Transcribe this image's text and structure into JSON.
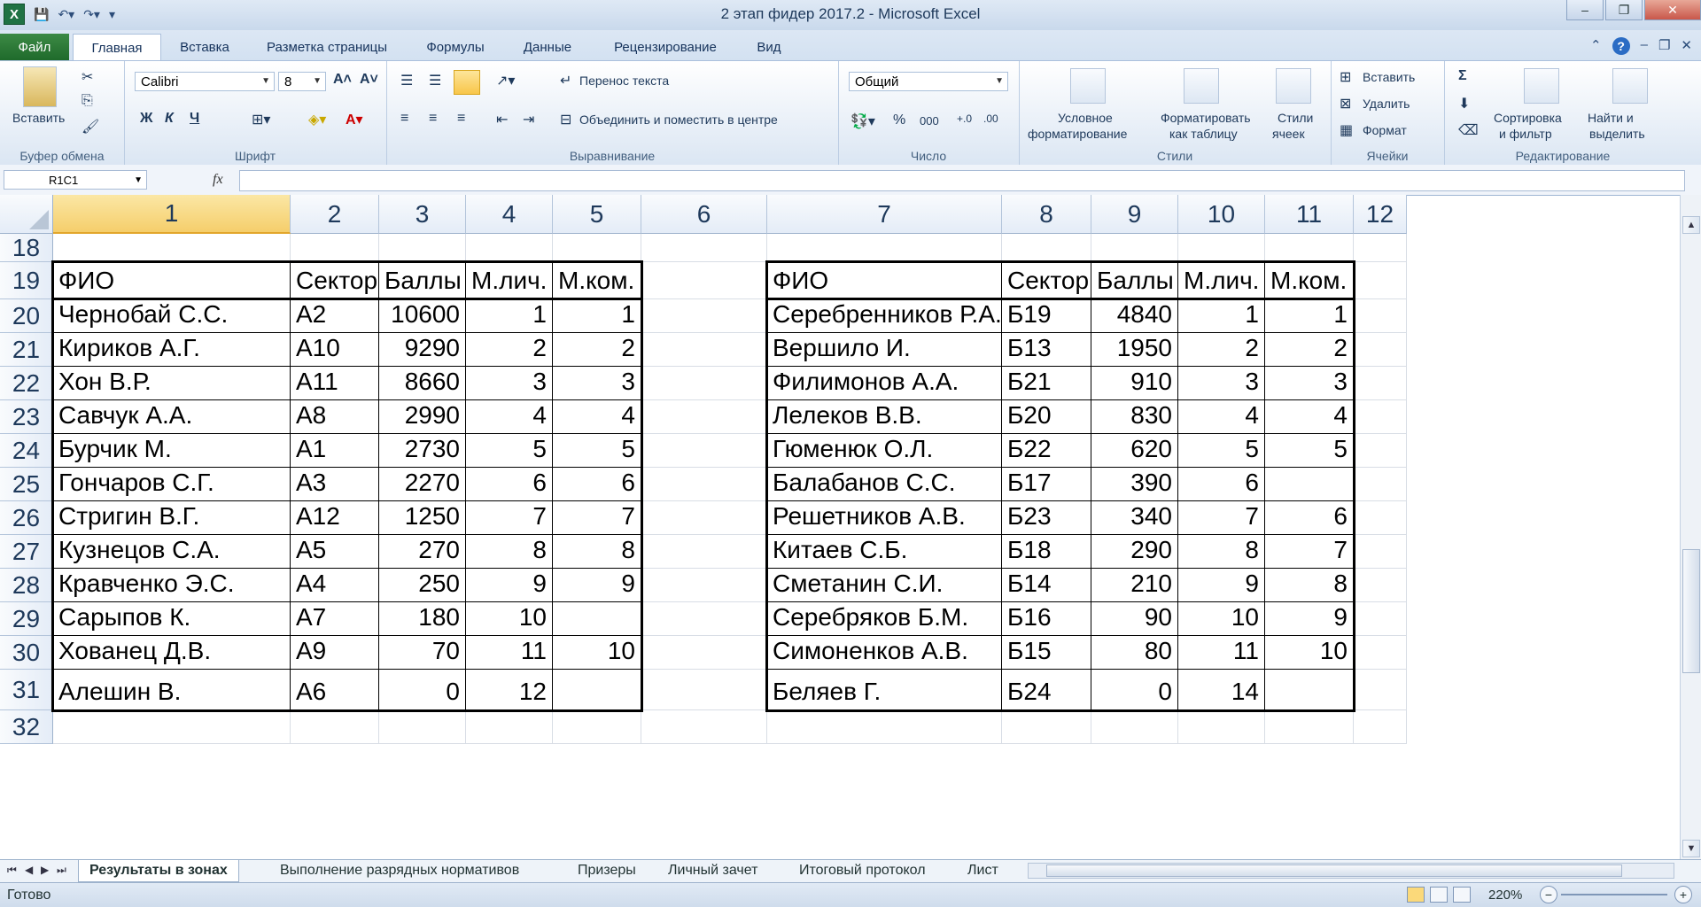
{
  "window": {
    "title": "2 этап фидер 2017.2 - Microsoft Excel",
    "controls": {
      "minimize": "–",
      "restore": "❐",
      "close": "✕"
    }
  },
  "ribbon_tabs": [
    {
      "label": "Файл"
    },
    {
      "label": "Главная"
    },
    {
      "label": "Вставка"
    },
    {
      "label": "Разметка страницы"
    },
    {
      "label": "Формулы"
    },
    {
      "label": "Данные"
    },
    {
      "label": "Рецензирование"
    },
    {
      "label": "Вид"
    }
  ],
  "ribbon": {
    "clipboard": {
      "label": "Буфер обмена",
      "paste": "Вставить"
    },
    "font": {
      "label": "Шрифт",
      "name": "Calibri",
      "size": "8",
      "bold": "Ж",
      "italic": "К",
      "underline": "Ч"
    },
    "alignment": {
      "label": "Выравнивание",
      "wrap": "Перенос текста",
      "merge": "Объединить и поместить в центре"
    },
    "number": {
      "label": "Число",
      "format": "Общий",
      "percent": "%",
      "thousands": "000"
    },
    "styles": {
      "label": "Стили",
      "conditional": "Условное",
      "conditional2": "форматирование",
      "table": "Форматировать",
      "table2": "как таблицу",
      "cell": "Стили",
      "cell2": "ячеек"
    },
    "cells": {
      "label": "Ячейки",
      "insert": "Вставить",
      "delete": "Удалить",
      "format": "Формат"
    },
    "editing": {
      "label": "Редактирование",
      "sort": "Сортировка",
      "sort2": "и фильтр",
      "find": "Найти и",
      "find2": "выделить",
      "sum": "Σ"
    }
  },
  "formula_bar": {
    "name_box": "R1C1",
    "fx": "fx",
    "value": ""
  },
  "columns": [
    "1",
    "2",
    "3",
    "4",
    "5",
    "6",
    "7",
    "8",
    "9",
    "10",
    "11",
    "12"
  ],
  "rows": [
    "18",
    "19",
    "20",
    "21",
    "22",
    "23",
    "24",
    "25",
    "26",
    "27",
    "28",
    "29",
    "30",
    "31",
    "32"
  ],
  "table_left": {
    "headers": [
      "ФИО",
      "Сектор",
      "Баллы",
      "М.лич.",
      "М.ком."
    ],
    "rows": [
      [
        "Чернобай С.С.",
        "А2",
        "10600",
        "1",
        "1"
      ],
      [
        "Кириков А.Г.",
        "А10",
        "9290",
        "2",
        "2"
      ],
      [
        "Хон В.Р.",
        "А11",
        "8660",
        "3",
        "3"
      ],
      [
        "Савчук А.А.",
        "А8",
        "2990",
        "4",
        "4"
      ],
      [
        "Бурчик М.",
        "А1",
        "2730",
        "5",
        "5"
      ],
      [
        "Гончаров С.Г.",
        "А3",
        "2270",
        "6",
        "6"
      ],
      [
        "Стригин В.Г.",
        "А12",
        "1250",
        "7",
        "7"
      ],
      [
        "Кузнецов С.А.",
        "А5",
        "270",
        "8",
        "8"
      ],
      [
        "Кравченко Э.С.",
        "А4",
        "250",
        "9",
        "9"
      ],
      [
        "Сарыпов К.",
        "А7",
        "180",
        "10",
        ""
      ],
      [
        "Хованец Д.В.",
        "А9",
        "70",
        "11",
        "10"
      ],
      [
        "Алешин В.",
        "А6",
        "0",
        "12",
        ""
      ]
    ]
  },
  "table_right": {
    "headers": [
      "ФИО",
      "Сектор",
      "Баллы",
      "М.лич.",
      "М.ком."
    ],
    "rows": [
      [
        "Серебренников Р.А.",
        "Б19",
        "4840",
        "1",
        "1"
      ],
      [
        "Вершило И.",
        "Б13",
        "1950",
        "2",
        "2"
      ],
      [
        "Филимонов А.А.",
        "Б21",
        "910",
        "3",
        "3"
      ],
      [
        "Лелеков В.В.",
        "Б20",
        "830",
        "4",
        "4"
      ],
      [
        "Гюменюк О.Л.",
        "Б22",
        "620",
        "5",
        "5"
      ],
      [
        "Балабанов С.С.",
        "Б17",
        "390",
        "6",
        ""
      ],
      [
        "Решетников А.В.",
        "Б23",
        "340",
        "7",
        "6"
      ],
      [
        "Китаев С.Б.",
        "Б18",
        "290",
        "8",
        "7"
      ],
      [
        "Сметанин С.И.",
        "Б14",
        "210",
        "9",
        "8"
      ],
      [
        "Серебряков Б.М.",
        "Б16",
        "90",
        "10",
        "9"
      ],
      [
        "Симоненков А.В.",
        "Б15",
        "80",
        "11",
        "10"
      ],
      [
        "Беляев Г.",
        "Б24",
        "0",
        "14",
        ""
      ]
    ]
  },
  "sheet_tabs": [
    "Результаты в зонах",
    "Выполнение разрядных нормативов",
    "Призеры",
    "Личный зачет",
    "Итоговый протокол",
    "Лист"
  ],
  "status": {
    "ready": "Готово",
    "zoom": "220%"
  }
}
